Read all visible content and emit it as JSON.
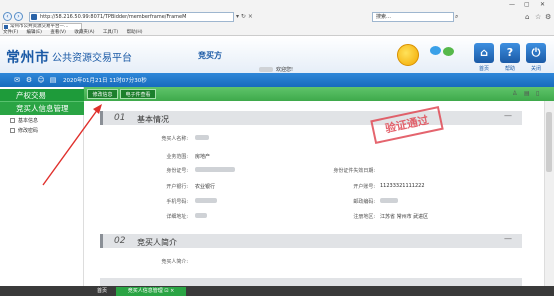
{
  "browser": {
    "address": "http://58.216.50.99:8071/TPBidder/memberframe/FrameM",
    "address_tail": "▾ ↻ ×",
    "tab_title": "常州市公共资源交易平台—…",
    "search_placeholder": "搜索…",
    "menu": [
      "文件(F)",
      "编辑(E)",
      "查看(V)",
      "收藏夹(A)",
      "工具(T)",
      "帮助(H)"
    ]
  },
  "header": {
    "logo_main": "常州市",
    "logo_sub": "公共资源交易平台",
    "role": "竞买方",
    "welcome": "欢迎您!",
    "buttons": [
      {
        "label": "首页",
        "icon": "home-icon",
        "glyph": "⌂"
      },
      {
        "label": "帮助",
        "icon": "help-icon",
        "glyph": "?"
      },
      {
        "label": "关闭",
        "icon": "power-icon",
        "glyph": "⏻"
      }
    ]
  },
  "bluebar": {
    "datetime": "2020年01月21日 11时07分30秒",
    "icons": [
      "chat-icon",
      "gear-icon",
      "people-icon",
      "printer-icon"
    ]
  },
  "sidebar": {
    "categories": [
      "产权交易",
      "竞买人信息管理"
    ],
    "items": [
      "基本信息",
      "修改密码"
    ]
  },
  "toolbar": {
    "tabs": [
      "修改信息",
      "电子件查看"
    ],
    "right_icons": [
      "person-icon",
      "print-icon",
      "export-icon"
    ]
  },
  "section1": {
    "num": "01",
    "title": "基本情况",
    "stamp": "验证通过",
    "fields_left": [
      {
        "label": "竞买人名称:",
        "value": ""
      },
      {
        "label": "业务范围:",
        "value": "房地产"
      },
      {
        "label": "身份证号:",
        "value": ""
      },
      {
        "label": "开户银行:",
        "value": "农业银行"
      },
      {
        "label": "手机号码:",
        "value": ""
      },
      {
        "label": "详细地址:",
        "value": ""
      }
    ],
    "fields_right": [
      {
        "label": "身份证件失效日期:",
        "value": ""
      },
      {
        "label": "开户账号:",
        "value": "11233321111222"
      },
      {
        "label": "邮政编码:",
        "value": ""
      },
      {
        "label": "注册地区:",
        "value": "江苏省 常州市 武进区"
      }
    ]
  },
  "section2": {
    "num": "02",
    "title": "竞买人简介",
    "field_label": "竞买人简介:"
  },
  "bottom": {
    "tabs": [
      "首页",
      "竞买人信息管理 ⊡ ×"
    ]
  },
  "colors": {
    "brand_blue": "#1b5aa6",
    "green": "#2aa444",
    "stamp_red": "#e04a55"
  }
}
